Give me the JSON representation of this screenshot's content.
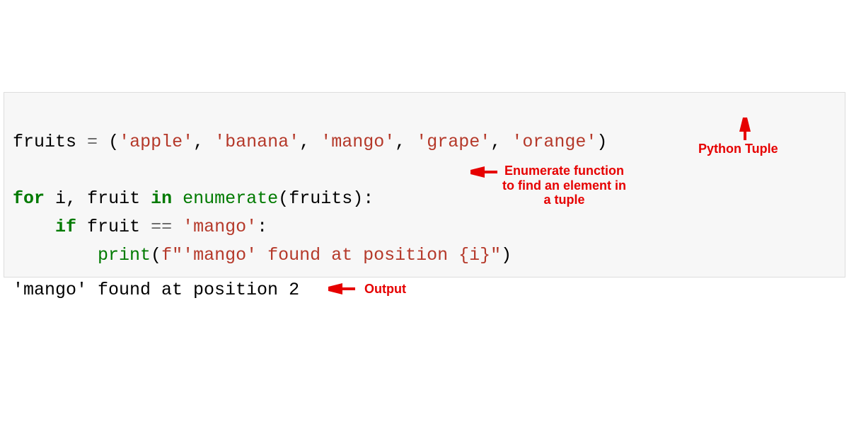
{
  "code": {
    "l1_var": "fruits",
    "l1_eq": "=",
    "l1_p1": "(",
    "l1_s1": "'apple'",
    "l1_c1": ",",
    "l1_s2": "'banana'",
    "l1_c2": ",",
    "l1_s3": "'mango'",
    "l1_c3": ",",
    "l1_s4": "'grape'",
    "l1_c4": ",",
    "l1_s5": "'orange'",
    "l1_p2": ")",
    "l3_for": "for",
    "l3_i": "i",
    "l3_c1": ",",
    "l3_fruit": "fruit",
    "l3_in": "in",
    "l3_enum": "enumerate",
    "l3_p1": "(",
    "l3_arg": "fruits",
    "l3_p2": "):",
    "l4_if": "if",
    "l4_fruit": "fruit",
    "l4_eq": "==",
    "l4_s": "'mango'",
    "l4_colon": ":",
    "l5_print": "print",
    "l5_p1": "(",
    "l5_f": "f\"'mango' found at position ",
    "l5_expr": "{i}",
    "l5_end": "\"",
    "l5_p2": ")"
  },
  "output": "'mango' found at position 2",
  "annotations": {
    "tuple": "Python Tuple",
    "enum": "Enumerate function\nto find an element in\na tuple",
    "out": "Output"
  }
}
